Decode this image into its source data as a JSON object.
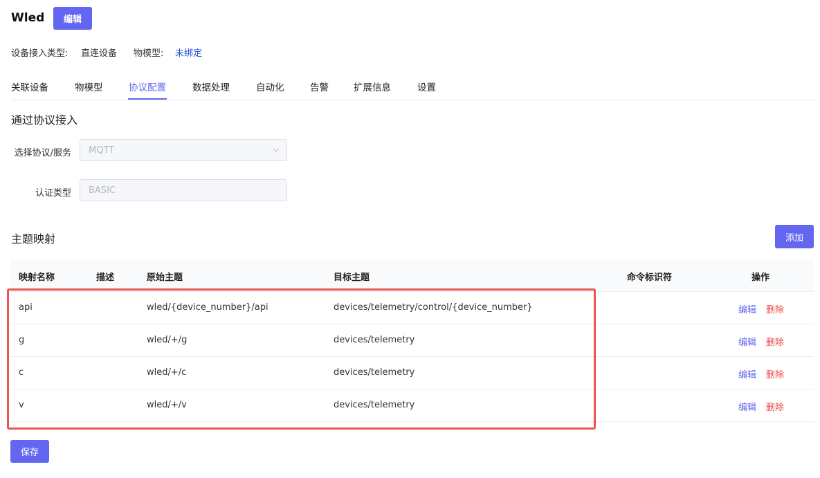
{
  "header": {
    "title": "Wled",
    "edit_label": "编辑"
  },
  "meta": {
    "access_type_label": "设备接入类型:",
    "access_type_value": "直连设备",
    "model_label": "物模型:",
    "model_value": "未绑定"
  },
  "tabs": [
    {
      "label": "关联设备"
    },
    {
      "label": "物模型"
    },
    {
      "label": "协议配置",
      "active": true
    },
    {
      "label": "数据处理"
    },
    {
      "label": "自动化"
    },
    {
      "label": "告警"
    },
    {
      "label": "扩展信息"
    },
    {
      "label": "设置"
    }
  ],
  "protocol": {
    "section_title": "通过协议接入",
    "protocol_label": "选择协议/服务",
    "protocol_value": "MQTT",
    "auth_label": "认证类型",
    "auth_value": "BASIC"
  },
  "mapping": {
    "section_title": "主题映射",
    "add_label": "添加",
    "columns": [
      "映射名称",
      "描述",
      "原始主题",
      "目标主题",
      "命令标识符",
      "操作"
    ],
    "rows": [
      {
        "name": "api",
        "desc": "",
        "source": "wled/{device_number}/api",
        "target": "devices/telemetry/control/{device_number}",
        "cmd": ""
      },
      {
        "name": "g",
        "desc": "",
        "source": "wled/+/g",
        "target": "devices/telemetry",
        "cmd": ""
      },
      {
        "name": "c",
        "desc": "",
        "source": "wled/+/c",
        "target": "devices/telemetry",
        "cmd": ""
      },
      {
        "name": "v",
        "desc": "",
        "source": "wled/+/v",
        "target": "devices/telemetry",
        "cmd": ""
      }
    ],
    "edit_label": "编辑",
    "delete_label": "删除"
  },
  "footer": {
    "save_label": "保存"
  },
  "colors": {
    "accent": "#6366f1",
    "danger": "#ef4444",
    "highlight": "#ef5350"
  }
}
